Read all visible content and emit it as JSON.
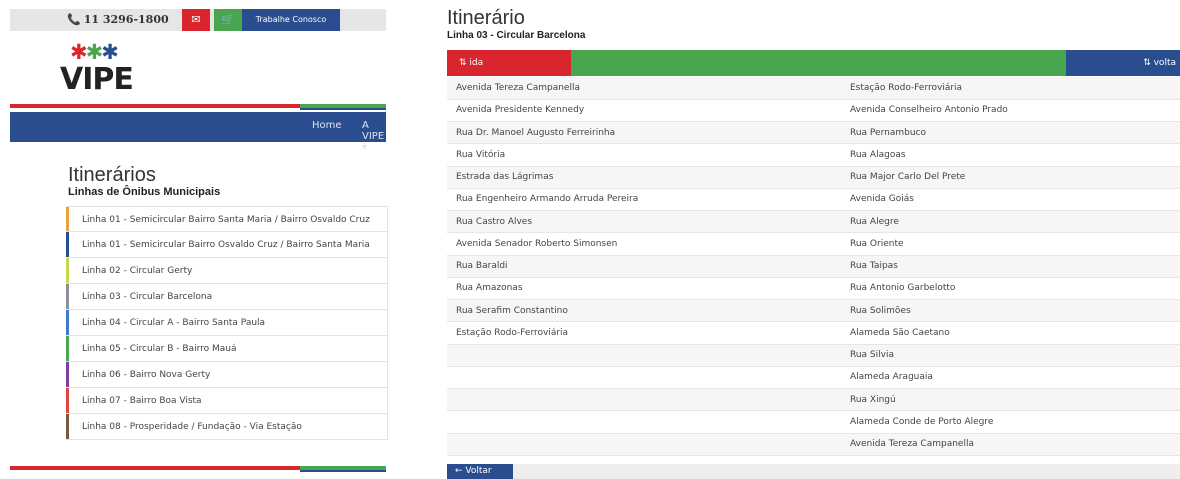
{
  "header": {
    "phone": "11 3296-1800",
    "work_label": "Trabalhe Conosco",
    "icons": {
      "phone": "phone-icon",
      "mail": "envelope-icon",
      "cart": "cart-icon"
    }
  },
  "logo": {
    "text": "VIPE"
  },
  "nav": {
    "home": "Home",
    "vipe": "A VIPE ▾"
  },
  "itinerarios": {
    "title": "Itinerários",
    "subtitle": "Linhas de Ônibus Municipais",
    "lines": [
      {
        "label": "Linha 01 - Semicircular Bairro Santa Maria / Bairro Osvaldo Cruz",
        "color": "#e8a33b"
      },
      {
        "label": "Linha 01 - Semicircular Bairro Osvaldo Cruz / Bairro Santa Maria",
        "color": "#2a4d8f"
      },
      {
        "label": "Linha 02 - Circular Gerty",
        "color": "#c9d64f"
      },
      {
        "label": "Linha 03 - Circular Barcelona",
        "color": "#8a8f9c"
      },
      {
        "label": "Linha 04 - Circular A - Bairro Santa Paula",
        "color": "#3f7ec7"
      },
      {
        "label": "Linha 05 - Circular B - Bairro Mauá",
        "color": "#4aa54f"
      },
      {
        "label": "Linha 06 - Bairro Nova Gerty",
        "color": "#7c3fa0"
      },
      {
        "label": "Linha 07 - Bairro Boa Vista",
        "color": "#e0463c"
      },
      {
        "label": "Linha 08 - Prosperidade / Fundação - Via Estação",
        "color": "#7a5a3a"
      }
    ]
  },
  "itinerario": {
    "title": "Itinerário",
    "subtitle": "Linha 03 - Circular Barcelona",
    "ida_label": "ida",
    "volta_label": "volta",
    "ida": [
      "Avenida Tereza Campanella",
      "Avenida Presidente Kennedy",
      "Rua Dr. Manoel Augusto Ferreirinha",
      "Rua Vitória",
      "Estrada das Lágrimas",
      "Rua Engenheiro Armando Arruda Pereira",
      "Rua Castro Alves",
      "Avenida Senador Roberto Simonsen",
      "Rua Baraldi",
      "Rua Amazonas",
      "Rua Serafim Constantino",
      "Estação Rodo-Ferroviária",
      "",
      "",
      "",
      "",
      ""
    ],
    "volta": [
      "Estação Rodo-Ferroviária",
      "Avenida Conselheiro Antonio Prado",
      "Rua Pernambuco",
      "Rua Alagoas",
      "Rua Major Carlo Del Prete",
      "Avenida Goiás",
      "Rua Alegre",
      "Rua Oriente",
      "Rua Taipas",
      "Rua Antonio Garbelotto",
      "Rua Solimões",
      "Alameda São Caetano",
      "Rua Silvia",
      "Alameda Araguaia",
      "Rua Xingú",
      "Alameda Conde de Porto Alegre",
      "Avenida Tereza Campanella"
    ],
    "back_label": "Voltar"
  },
  "colors": {
    "red": "#d9262e",
    "green": "#4aa54f",
    "blue": "#2a4d8f"
  }
}
